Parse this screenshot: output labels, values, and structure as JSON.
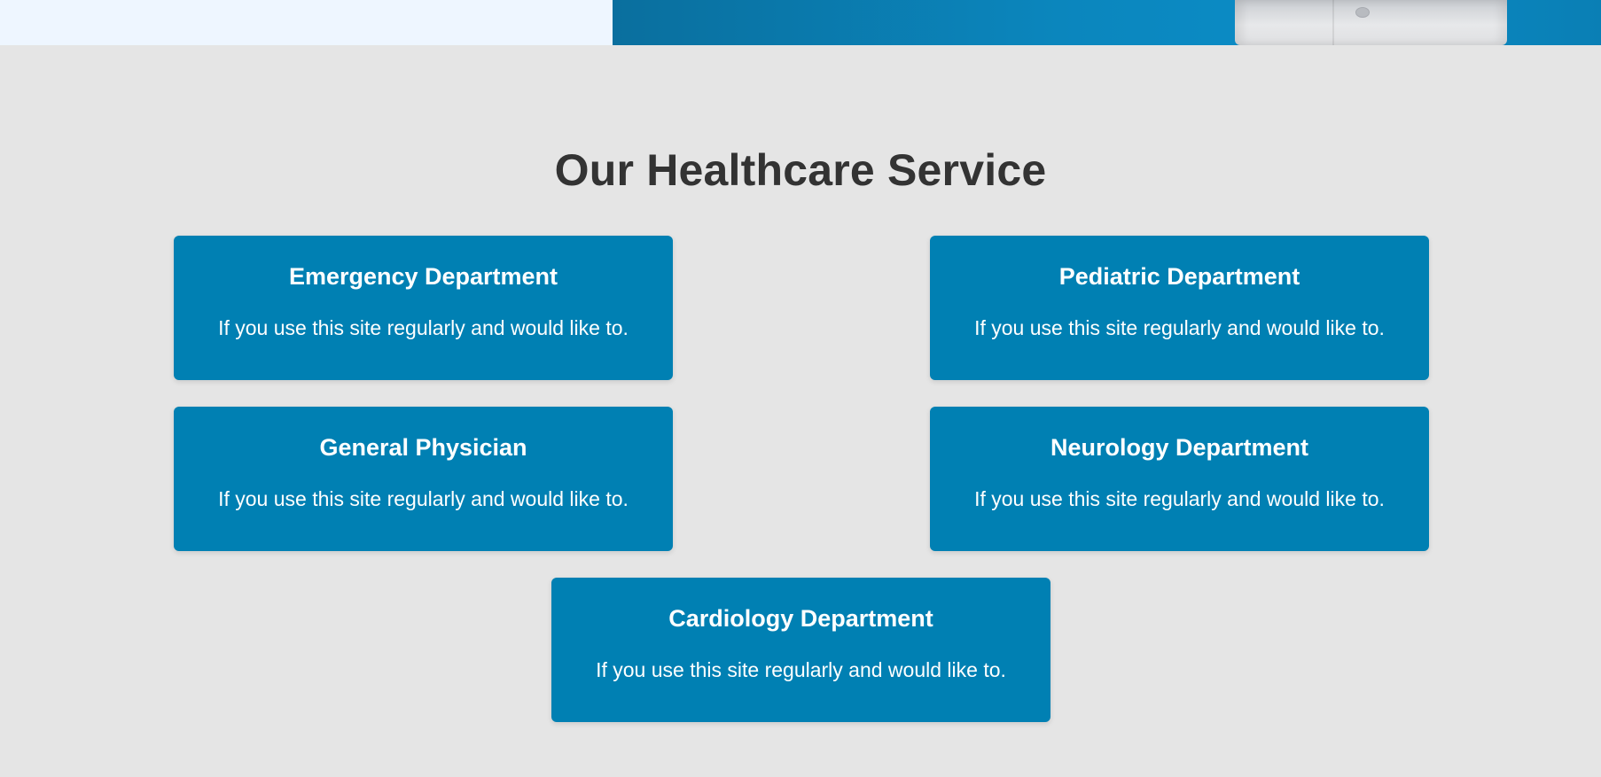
{
  "colors": {
    "page_background": "#e5e5e5",
    "hero_left": "#eef6ff",
    "hero_right": "#0b86bd",
    "card_background": "#0080b3",
    "title_text": "#333333",
    "card_text": "#ffffff"
  },
  "services": {
    "title": "Our Healthcare Service",
    "cards": [
      {
        "title": "Emergency Department",
        "text": "If you use this site regularly and would like to."
      },
      {
        "title": "Pediatric Department",
        "text": "If you use this site regularly and would like to."
      },
      {
        "title": "General Physician",
        "text": "If you use this site regularly and would like to."
      },
      {
        "title": "Neurology Department",
        "text": "If you use this site regularly and would like to."
      },
      {
        "title": "Cardiology Department",
        "text": "If you use this site regularly and would like to."
      }
    ]
  }
}
